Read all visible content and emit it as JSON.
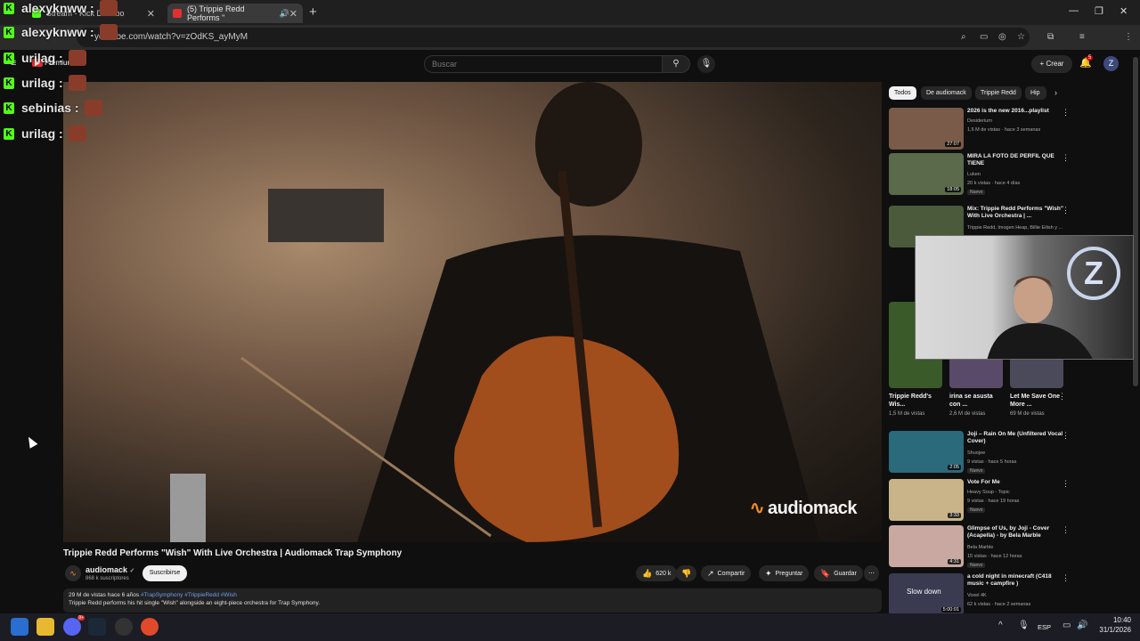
{
  "browser": {
    "tabs": [
      {
        "title": "Stream - Kick Dashbo"
      },
      {
        "title": "(5) Trippie Redd Performs \""
      }
    ],
    "url": "youtube.com/watch?v=zOdKS_ayMyM"
  },
  "youtube": {
    "logo": "Premium",
    "search_placeholder": "Buscar",
    "create_label": "Crear",
    "notification_count": "5",
    "avatar_letter": "Z"
  },
  "chat_overlay": [
    {
      "user": "alexyknww :"
    },
    {
      "user": "alexyknww :"
    },
    {
      "user": "urilag :"
    },
    {
      "user": "urilag :"
    },
    {
      "user": "sebinias :"
    },
    {
      "user": "urilag :"
    }
  ],
  "video": {
    "watermark": "audiomack",
    "title": "Trippie Redd Performs \"Wish\" With Live Orchestra | Audiomack Trap Symphony",
    "channel": "audiomack",
    "subscribers": "868 k suscriptores",
    "subscribe_label": "Suscribirse",
    "likes": "620 k",
    "share_label": "Compartir",
    "ask_label": "Preguntar",
    "save_label": "Guardar",
    "views_date": "29 M de vistas  hace 6 años",
    "tags": "#TrapSymphony #TrippieRedd #Wish",
    "description": "Trippie Redd performs his hit single \"Wish\" alongside an eight-piece orchestra for Trap Symphony."
  },
  "chips": [
    "Todos",
    "De audiomack",
    "Trippie Redd",
    "Hip h"
  ],
  "recommendations": [
    {
      "title": "2026 is the new 2016...playlist",
      "channel": "Desiderium",
      "meta": "1,6 M de vistas · hace 3 semanas",
      "duration": "27:07",
      "new": "",
      "color": "#7a5a48"
    },
    {
      "title": "MIRA LA FOTO DE PERFIL QUE TIENE",
      "channel": "Luken",
      "meta": "20 k vistas · hace 4 días",
      "duration": "18:05",
      "new": "Nuevo",
      "color": "#5a6a4a"
    },
    {
      "title": "Mix: Trippie Redd Performs \"Wish\" With Live Orchestra | ...",
      "channel": "Trippie Redd, Imogen Heap, Billie Eilish y ...",
      "meta": "",
      "duration": "",
      "new": "",
      "color": "#4a5a3a"
    }
  ],
  "shorts": [
    {
      "title": "Trippie Redd's Wis...",
      "views": "1,5 M de vistas"
    },
    {
      "title": "irina se asusta con ...",
      "views": "2,6 M de vistas"
    },
    {
      "title": "Let Me Save One More ...",
      "views": "69 M de vistas"
    }
  ],
  "recommendations2": [
    {
      "title": "Joji – Rain On Me (Unfiltered Vocal Cover)",
      "channel": "Shuojee",
      "meta": "9 vistas · hace 5 horas",
      "duration": "2:05",
      "new": "Nuevo",
      "color": "#2a6a7a"
    },
    {
      "title": "Vote For Me",
      "channel": "Heavy Soup - Topic",
      "meta": "9 vistas · hace 19 horas",
      "duration": "3:33",
      "new": "Nuevo",
      "color": "#c8b488"
    },
    {
      "title": "Glimpse of Us, by Joji - Cover (Acapella) - by Bela Marble",
      "channel": "Bela Marble",
      "meta": "15 vistas · hace 12 horas",
      "duration": "4:31",
      "new": "Nuevo",
      "color": "#c8a8a0"
    },
    {
      "title": "a cold night in minecraft (C418 music + campfire )",
      "channel": "Voxel 4K",
      "meta": "62 k vistas · hace 2 semanas",
      "duration": "5:00:01",
      "new": "",
      "thumb_text": "Slow down",
      "color": "#3a3a50"
    }
  ],
  "webcam": {
    "logo_letter": "Z"
  },
  "taskbar": {
    "lang": "ESP",
    "time": "10:40",
    "date": "31/1/2026",
    "discord_badge": "9+"
  }
}
